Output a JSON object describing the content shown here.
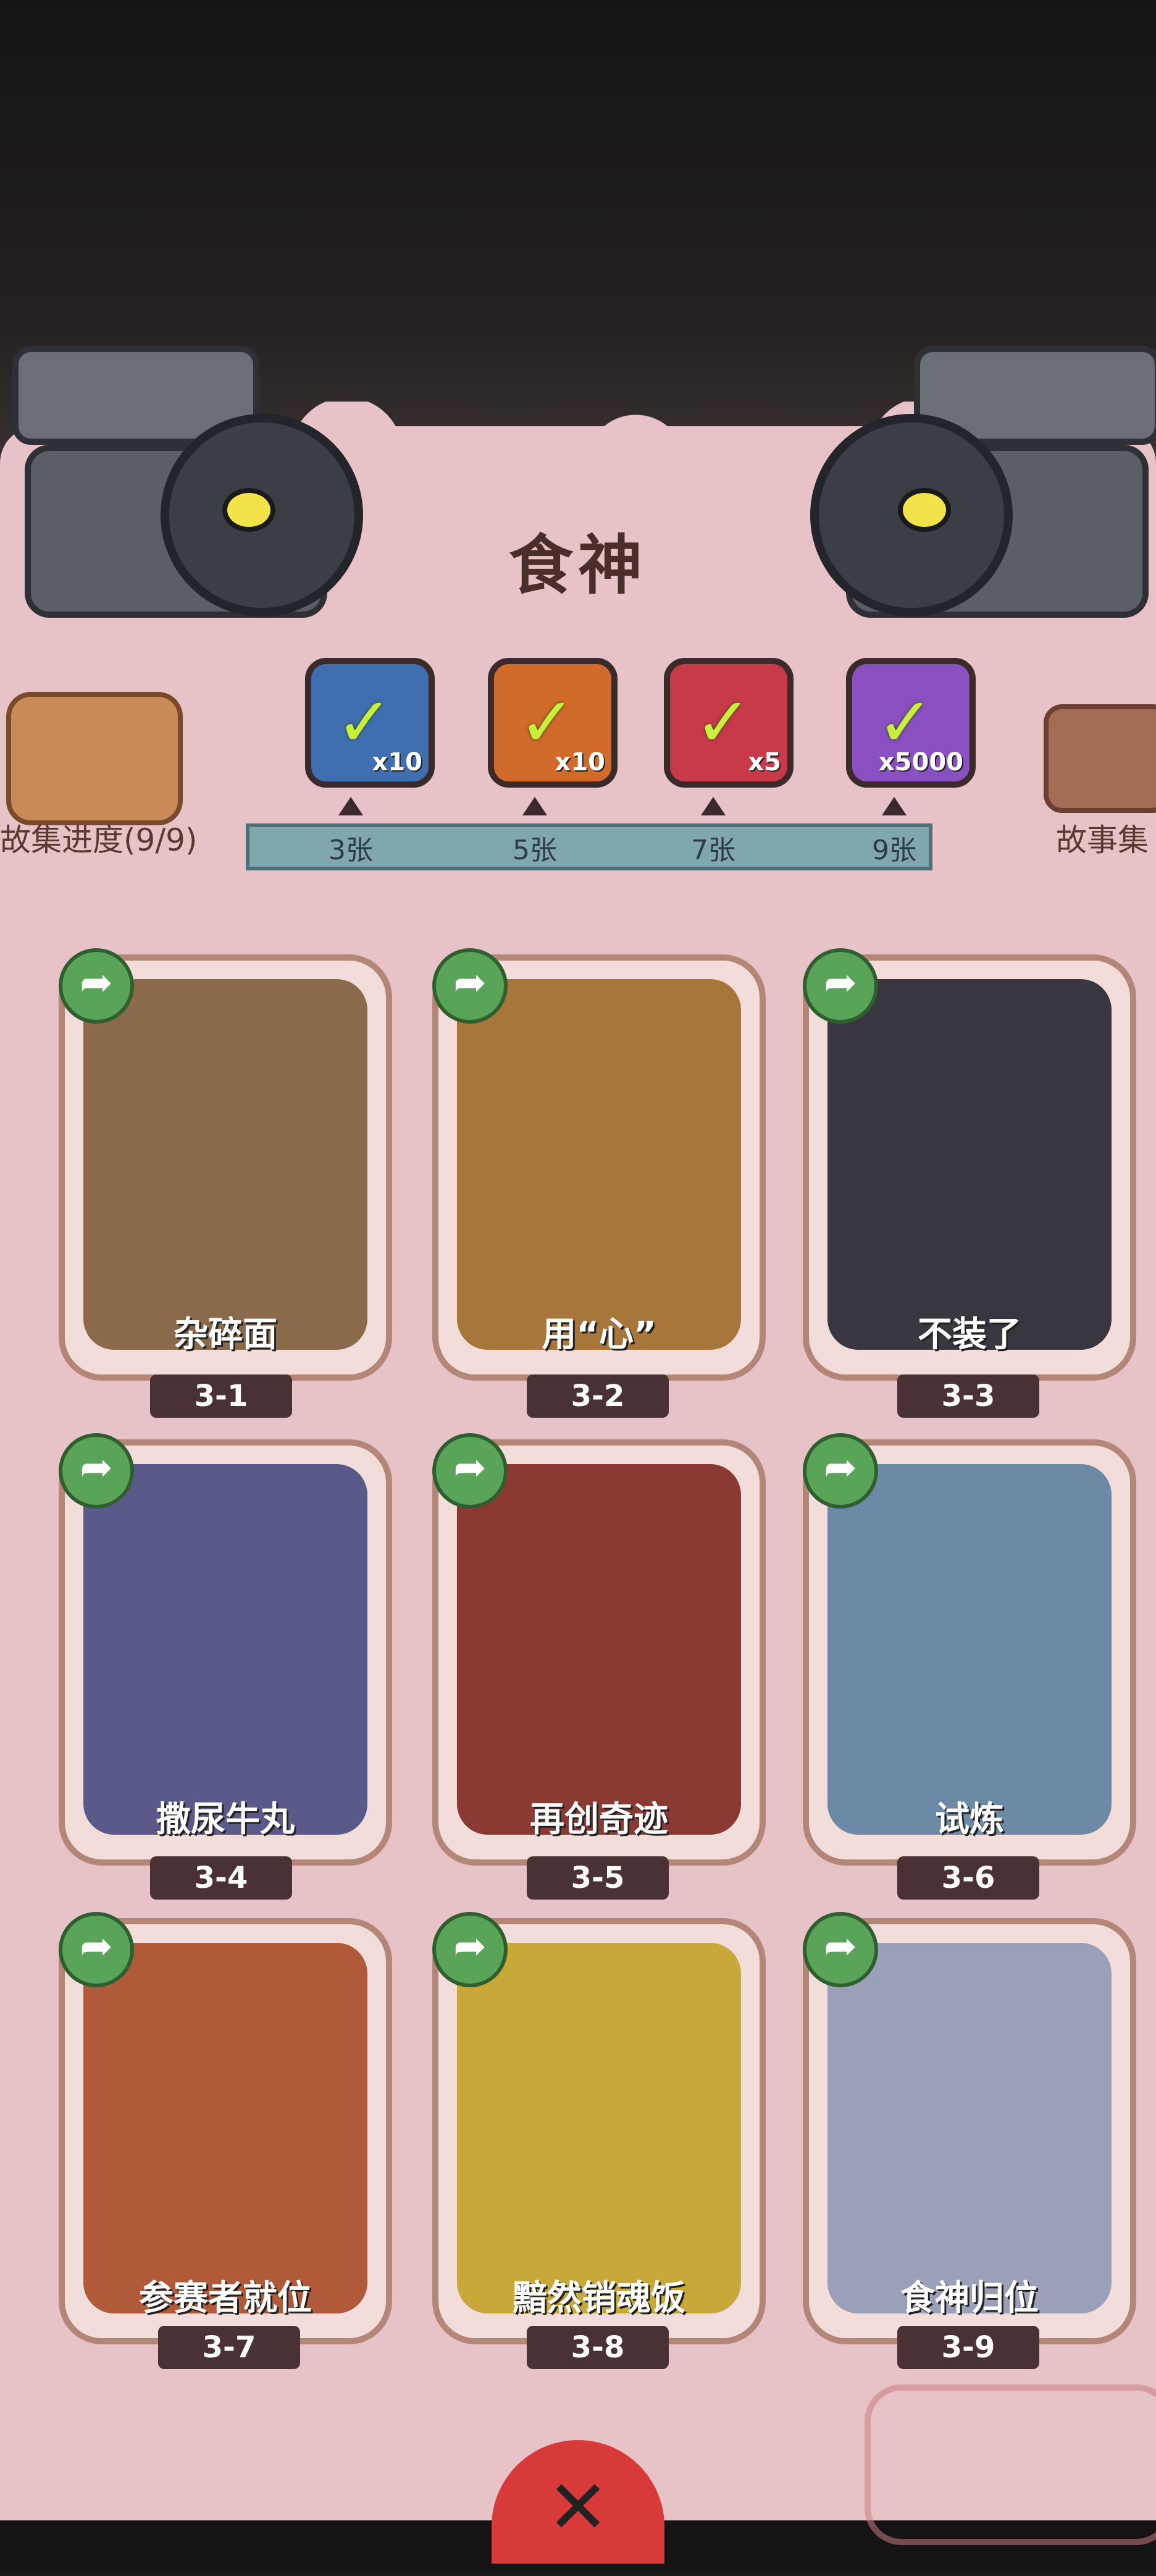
{
  "title": "食神",
  "side_left_label": "故集进度(9/9)",
  "side_right_label": "故事集",
  "rewards": [
    {
      "qty": "x10",
      "color": "#3f6fb0",
      "icon": "chest-check-icon"
    },
    {
      "qty": "x10",
      "color": "#d26a2a",
      "icon": "ticket-check-icon"
    },
    {
      "qty": "x5",
      "color": "#c83a4a",
      "icon": "orb-check-icon"
    },
    {
      "qty": "x5000",
      "color": "#8a4fc0",
      "icon": "silver-check-icon"
    }
  ],
  "milestones": [
    "3张",
    "5张",
    "7张",
    "9张"
  ],
  "cards": [
    {
      "caption": "杂碎面",
      "tag": "3-1",
      "bg": "#8a6a4a"
    },
    {
      "caption": "用“心”",
      "tag": "3-2",
      "bg": "#a8763a"
    },
    {
      "caption": "不装了",
      "tag": "3-3",
      "bg": "#3a3640"
    },
    {
      "caption": "撒尿牛丸",
      "tag": "3-4",
      "bg": "#5a5a8a"
    },
    {
      "caption": "再创奇迹",
      "tag": "3-5",
      "bg": "#8a3a32"
    },
    {
      "caption": "试炼",
      "tag": "3-6",
      "bg": "#6c8aa6"
    },
    {
      "caption": "参赛者就位",
      "tag": "3-7",
      "bg": "#b05a3a"
    },
    {
      "caption": "黯然销魂饭",
      "tag": "3-8",
      "bg": "#c9a83a"
    },
    {
      "caption": "食神归位",
      "tag": "3-9",
      "bg": "#9aa0b8"
    }
  ]
}
